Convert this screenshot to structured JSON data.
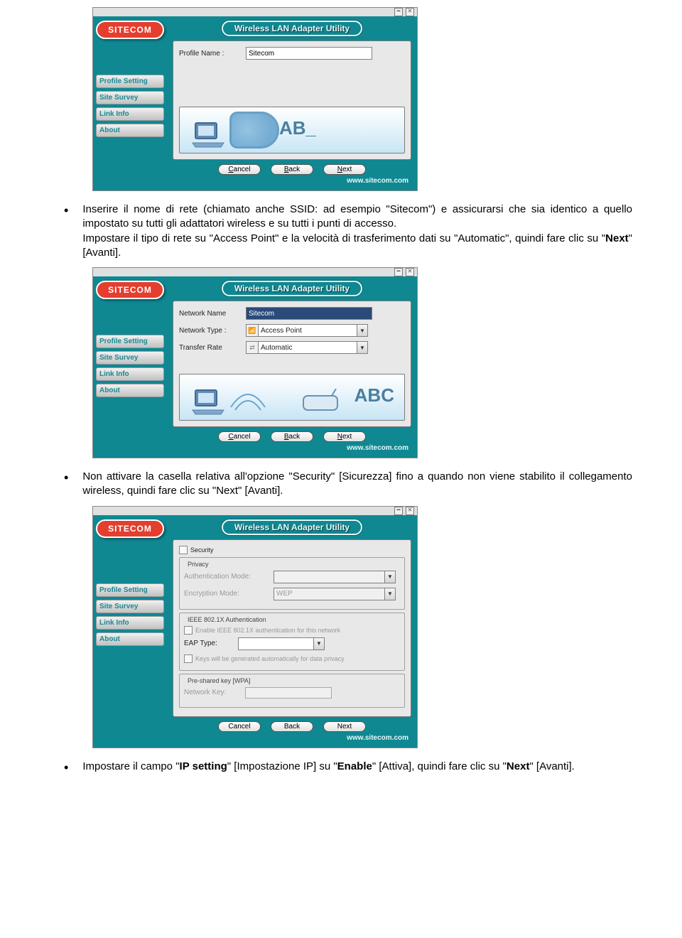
{
  "brand": "SITECOM",
  "window_title": "Wireless LAN Adapter Utility",
  "footer_url": "www.sitecom.com",
  "sidebar": {
    "items": [
      {
        "label": "Profile Setting"
      },
      {
        "label": "Site Survey"
      },
      {
        "label": "Link Info"
      },
      {
        "label": "About"
      }
    ]
  },
  "buttons": {
    "cancel": "Cancel",
    "back": "Back",
    "next": "Next"
  },
  "screenshot1": {
    "profile_name_label": "Profile Name :",
    "profile_name_value": "Sitecom",
    "illu_text": "AB_"
  },
  "screenshot2": {
    "network_name_label": "Network Name",
    "network_name_value": "Sitecom",
    "network_type_label": "Network Type :",
    "network_type_value": "Access Point",
    "transfer_rate_label": "Transfer Rate",
    "transfer_rate_value": "Automatic",
    "illu_text": "ABC"
  },
  "screenshot3": {
    "security_label": "Security",
    "privacy_legend": "Privacy",
    "auth_mode_label": "Authentication Mode:",
    "encryption_mode_label": "Encryption Mode:",
    "encryption_mode_value": "WEP",
    "ieee_legend": "IEEE 802.1X Authentication",
    "enable_8021x_label": "Enable IEEE 802.1X authentication for this network",
    "eap_type_label": "EAP Type:",
    "keys_auto_label": "Keys will be generated automatically for data privacy",
    "psk_legend": "Pre-shared key [WPA]",
    "network_key_label": "Network Key:"
  },
  "bullet1": "Inserire il nome di rete (chiamato anche SSID: ad esempio \"Sitecom\") e assicurarsi che sia identico a quello impostato su tutti gli adattatori wireless e su tutti i punti di accesso.",
  "bullet1b": "Impostare il tipo di rete su \"Access Point\" e la velocità di trasferimento dati su \"Automatic\", quindi fare clic su \"",
  "bullet1b_bold": "Next",
  "bullet1b_tail": "\" [Avanti].",
  "bullet2": "Non attivare la casella relativa all'opzione \"Security\" [Sicurezza] fino a quando non viene stabilito il collegamento wireless, quindi fare clic su \"Next\" [Avanti].",
  "bullet3_a": "Impostare il campo \"",
  "bullet3_b": "IP setting",
  "bullet3_c": "\" [Impostazione IP] su \"",
  "bullet3_d": "Enable",
  "bullet3_e": "\" [Attiva], quindi fare clic su \"",
  "bullet3_f": "Next",
  "bullet3_g": "\" [Avanti]."
}
